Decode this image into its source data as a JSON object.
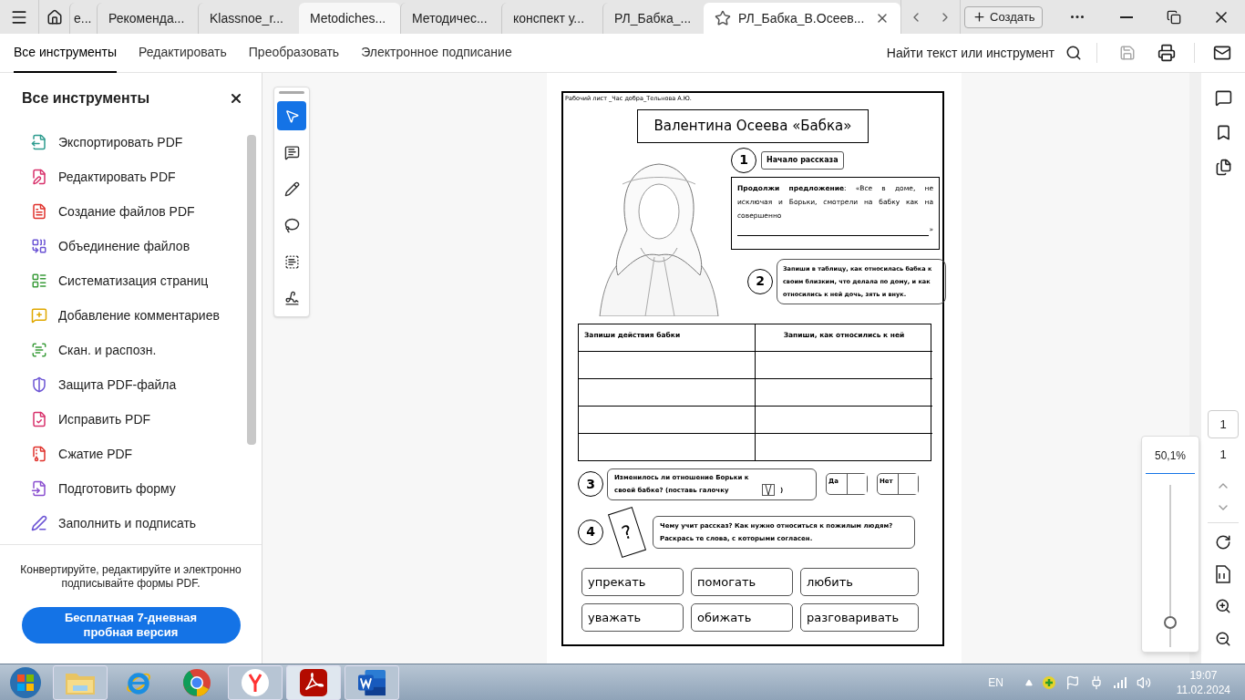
{
  "tabs": [
    {
      "label": "е...",
      "selected": false,
      "hovered": false
    },
    {
      "label": "Рекоменда...",
      "selected": false,
      "hovered": false
    },
    {
      "label": "Klassnoe_r...",
      "selected": false,
      "hovered": false
    },
    {
      "label": "Metodiches...",
      "selected": false,
      "hovered": true
    },
    {
      "label": "Методичес...",
      "selected": false,
      "hovered": false
    },
    {
      "label": "конспект у...",
      "selected": false,
      "hovered": false
    },
    {
      "label": "РЛ_Бабка_...",
      "selected": false,
      "hovered": false
    },
    {
      "label": "РЛ_Бабка_В.Осеев...",
      "selected": true,
      "hovered": false
    }
  ],
  "create_button": "Создать",
  "menu": [
    {
      "label": "Все инструменты",
      "selected": true
    },
    {
      "label": "Редактировать",
      "selected": false
    },
    {
      "label": "Преобразовать",
      "selected": false
    },
    {
      "label": "Электронное подписание",
      "selected": false
    }
  ],
  "find_label": "Найти текст или инструмент",
  "tools_panel": {
    "title": "Все инструменты",
    "items": [
      {
        "label": "Экспортировать PDF"
      },
      {
        "label": "Редактировать PDF"
      },
      {
        "label": "Создание файлов PDF"
      },
      {
        "label": "Объединение файлов"
      },
      {
        "label": "Систематизация страниц"
      },
      {
        "label": "Добавление комментариев"
      },
      {
        "label": "Скан. и распозн."
      },
      {
        "label": "Защита PDF-файла"
      },
      {
        "label": "Исправить PDF"
      },
      {
        "label": "Сжатие PDF"
      },
      {
        "label": "Подготовить форму"
      },
      {
        "label": "Заполнить и подписать"
      }
    ],
    "promo": "Конвертируйте, редактируйте и электронно подписывайте формы PDF.",
    "trial_button": "Бесплатная 7-дневная пробная версия"
  },
  "floating_tools": [
    {
      "selected": true
    },
    {
      "selected": false
    },
    {
      "selected": false
    },
    {
      "selected": false
    },
    {
      "selected": false
    },
    {
      "selected": false
    }
  ],
  "document": {
    "header": "Рабочий лист _Час добра_Тельнова А.Ю.",
    "title": "Валентина Осеева «Бабка»",
    "task1": {
      "number": "1",
      "label": "Начало рассказа",
      "text": "**Продолжи предложение**: «Все в доме, не исключая и Борьки, смотрели на бабку как на совершенно",
      "closing": "»"
    },
    "task2": {
      "number": "2",
      "text": "Запиши в таблицу, как относилась бабка к своим близким, что делала по дому, и как относились к ней дочь, зять и внук."
    },
    "table": {
      "columns": [
        "Запиши действия бабки",
        "Запиши, как относились к ней"
      ],
      "rows": [
        {
          "kind": "blank"
        },
        {
          "kind": "blank"
        },
        {
          "kind": "blank"
        },
        {
          "kind": "blank"
        }
      ]
    },
    "task3": {
      "number": "3",
      "text": "Изменилось ли отношение Борьки к своей бабке? (поставь галочку",
      "closing": ")",
      "options": [
        {
          "label": "Да",
          "checked": false
        },
        {
          "label": "Нет",
          "checked": false
        }
      ]
    },
    "task4": {
      "number": "4",
      "mark": "?",
      "text": "Чему учит рассказ? Как нужно относиться к пожилым людям? Раскрась те слова, с которыми согласен.",
      "words": [
        "упрекать",
        "помогать",
        "любить",
        "уважать",
        "обижать",
        "разговаривать"
      ]
    }
  },
  "page_nav": {
    "current": "1",
    "total": "1"
  },
  "zoom": {
    "reading": "50,1%",
    "level": 0.15
  },
  "taskbar": {
    "apps": [
      {
        "running": true,
        "selected": false
      },
      {
        "running": false,
        "selected": false
      },
      {
        "running": false,
        "selected": false
      },
      {
        "running": true,
        "selected": false
      },
      {
        "running": true,
        "selected": true
      },
      {
        "running": true,
        "selected": false
      }
    ]
  },
  "tray": {
    "language": "EN",
    "time": "19:07",
    "date": "11.02.2024"
  }
}
